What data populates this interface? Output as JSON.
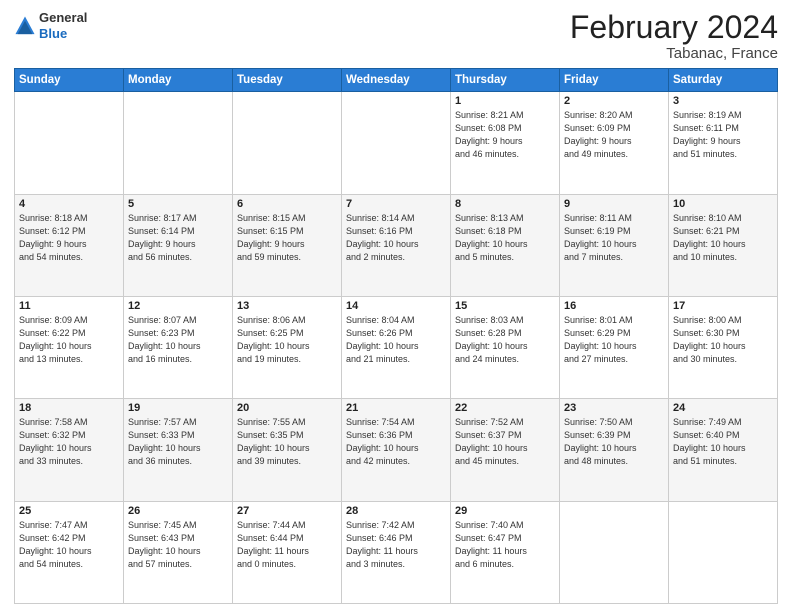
{
  "header": {
    "logo_line1": "General",
    "logo_line2": "Blue",
    "month": "February 2024",
    "location": "Tabanac, France"
  },
  "weekdays": [
    "Sunday",
    "Monday",
    "Tuesday",
    "Wednesday",
    "Thursday",
    "Friday",
    "Saturday"
  ],
  "weeks": [
    [
      {
        "day": "",
        "info": ""
      },
      {
        "day": "",
        "info": ""
      },
      {
        "day": "",
        "info": ""
      },
      {
        "day": "",
        "info": ""
      },
      {
        "day": "1",
        "info": "Sunrise: 8:21 AM\nSunset: 6:08 PM\nDaylight: 9 hours\nand 46 minutes."
      },
      {
        "day": "2",
        "info": "Sunrise: 8:20 AM\nSunset: 6:09 PM\nDaylight: 9 hours\nand 49 minutes."
      },
      {
        "day": "3",
        "info": "Sunrise: 8:19 AM\nSunset: 6:11 PM\nDaylight: 9 hours\nand 51 minutes."
      }
    ],
    [
      {
        "day": "4",
        "info": "Sunrise: 8:18 AM\nSunset: 6:12 PM\nDaylight: 9 hours\nand 54 minutes."
      },
      {
        "day": "5",
        "info": "Sunrise: 8:17 AM\nSunset: 6:14 PM\nDaylight: 9 hours\nand 56 minutes."
      },
      {
        "day": "6",
        "info": "Sunrise: 8:15 AM\nSunset: 6:15 PM\nDaylight: 9 hours\nand 59 minutes."
      },
      {
        "day": "7",
        "info": "Sunrise: 8:14 AM\nSunset: 6:16 PM\nDaylight: 10 hours\nand 2 minutes."
      },
      {
        "day": "8",
        "info": "Sunrise: 8:13 AM\nSunset: 6:18 PM\nDaylight: 10 hours\nand 5 minutes."
      },
      {
        "day": "9",
        "info": "Sunrise: 8:11 AM\nSunset: 6:19 PM\nDaylight: 10 hours\nand 7 minutes."
      },
      {
        "day": "10",
        "info": "Sunrise: 8:10 AM\nSunset: 6:21 PM\nDaylight: 10 hours\nand 10 minutes."
      }
    ],
    [
      {
        "day": "11",
        "info": "Sunrise: 8:09 AM\nSunset: 6:22 PM\nDaylight: 10 hours\nand 13 minutes."
      },
      {
        "day": "12",
        "info": "Sunrise: 8:07 AM\nSunset: 6:23 PM\nDaylight: 10 hours\nand 16 minutes."
      },
      {
        "day": "13",
        "info": "Sunrise: 8:06 AM\nSunset: 6:25 PM\nDaylight: 10 hours\nand 19 minutes."
      },
      {
        "day": "14",
        "info": "Sunrise: 8:04 AM\nSunset: 6:26 PM\nDaylight: 10 hours\nand 21 minutes."
      },
      {
        "day": "15",
        "info": "Sunrise: 8:03 AM\nSunset: 6:28 PM\nDaylight: 10 hours\nand 24 minutes."
      },
      {
        "day": "16",
        "info": "Sunrise: 8:01 AM\nSunset: 6:29 PM\nDaylight: 10 hours\nand 27 minutes."
      },
      {
        "day": "17",
        "info": "Sunrise: 8:00 AM\nSunset: 6:30 PM\nDaylight: 10 hours\nand 30 minutes."
      }
    ],
    [
      {
        "day": "18",
        "info": "Sunrise: 7:58 AM\nSunset: 6:32 PM\nDaylight: 10 hours\nand 33 minutes."
      },
      {
        "day": "19",
        "info": "Sunrise: 7:57 AM\nSunset: 6:33 PM\nDaylight: 10 hours\nand 36 minutes."
      },
      {
        "day": "20",
        "info": "Sunrise: 7:55 AM\nSunset: 6:35 PM\nDaylight: 10 hours\nand 39 minutes."
      },
      {
        "day": "21",
        "info": "Sunrise: 7:54 AM\nSunset: 6:36 PM\nDaylight: 10 hours\nand 42 minutes."
      },
      {
        "day": "22",
        "info": "Sunrise: 7:52 AM\nSunset: 6:37 PM\nDaylight: 10 hours\nand 45 minutes."
      },
      {
        "day": "23",
        "info": "Sunrise: 7:50 AM\nSunset: 6:39 PM\nDaylight: 10 hours\nand 48 minutes."
      },
      {
        "day": "24",
        "info": "Sunrise: 7:49 AM\nSunset: 6:40 PM\nDaylight: 10 hours\nand 51 minutes."
      }
    ],
    [
      {
        "day": "25",
        "info": "Sunrise: 7:47 AM\nSunset: 6:42 PM\nDaylight: 10 hours\nand 54 minutes."
      },
      {
        "day": "26",
        "info": "Sunrise: 7:45 AM\nSunset: 6:43 PM\nDaylight: 10 hours\nand 57 minutes."
      },
      {
        "day": "27",
        "info": "Sunrise: 7:44 AM\nSunset: 6:44 PM\nDaylight: 11 hours\nand 0 minutes."
      },
      {
        "day": "28",
        "info": "Sunrise: 7:42 AM\nSunset: 6:46 PM\nDaylight: 11 hours\nand 3 minutes."
      },
      {
        "day": "29",
        "info": "Sunrise: 7:40 AM\nSunset: 6:47 PM\nDaylight: 11 hours\nand 6 minutes."
      },
      {
        "day": "",
        "info": ""
      },
      {
        "day": "",
        "info": ""
      }
    ]
  ]
}
